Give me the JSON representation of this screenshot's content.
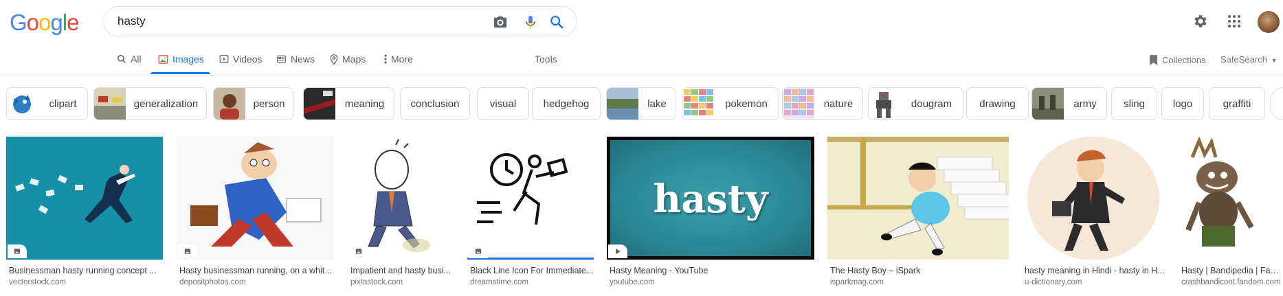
{
  "logo": {
    "letters": [
      "G",
      "o",
      "o",
      "g",
      "l",
      "e"
    ],
    "colors": [
      "#4285f4",
      "#ea4335",
      "#fbbc05",
      "#4285f4",
      "#34a853",
      "#ea4335"
    ]
  },
  "search": {
    "query": "hasty"
  },
  "tabs": [
    {
      "label": "All",
      "icon": "search-icon"
    },
    {
      "label": "Images",
      "icon": "image-icon"
    },
    {
      "label": "Videos",
      "icon": "play-icon"
    },
    {
      "label": "News",
      "icon": "news-icon"
    },
    {
      "label": "Maps",
      "icon": "map-pin-icon"
    },
    {
      "label": "More",
      "icon": "more-vert-icon"
    }
  ],
  "tools_label": "Tools",
  "collections_label": "Collections",
  "safesearch_label": "SafeSearch",
  "accent": "#1a73e8",
  "chips": [
    {
      "label": "clipart"
    },
    {
      "label": "generalization"
    },
    {
      "label": "person"
    },
    {
      "label": "meaning"
    },
    {
      "label": "conclusion"
    },
    {
      "label": "visual"
    },
    {
      "label": "hedgehog"
    },
    {
      "label": "lake"
    },
    {
      "label": "pokemon"
    },
    {
      "label": "nature"
    },
    {
      "label": "dougram"
    },
    {
      "label": "drawing"
    },
    {
      "label": "army"
    },
    {
      "label": "sling"
    },
    {
      "label": "logo"
    },
    {
      "label": "graffiti"
    }
  ],
  "results": [
    {
      "caption": "Businessman hasty running concept ...",
      "source": "vectorstock.com"
    },
    {
      "caption": "Hasty businessman running, on a whit...",
      "source": "depositphotos.com"
    },
    {
      "caption": "Impatient and hasty busi...",
      "source": "pixtastock.com"
    },
    {
      "caption": "Black Line Icon For Immediate...",
      "source": "dreamstime.com"
    },
    {
      "caption": "Hasty Meaning - YouTube",
      "source": "youtube.com",
      "image_text": "hasty"
    },
    {
      "caption": "The Hasty Boy – iSpark",
      "source": "isparkmag.com"
    },
    {
      "caption": "hasty meaning in Hindi - hasty in H...",
      "source": "u-dictionary.com"
    },
    {
      "caption": "Hasty | Bandipedia | Fand...",
      "source": "crashbandicoot.fandom.com"
    }
  ]
}
